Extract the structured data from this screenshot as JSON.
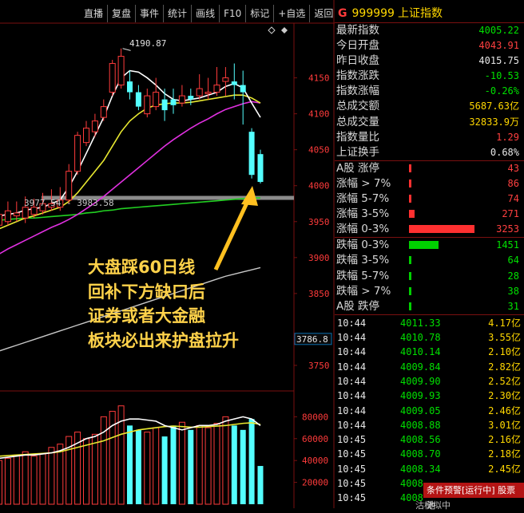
{
  "toolbar": [
    "直播",
    "复盘",
    "事件",
    "统计",
    "画线",
    "F10",
    "标记",
    "+自选",
    "返回"
  ],
  "header": {
    "letter": "G",
    "code": "999999",
    "name": "上证指数"
  },
  "quote": [
    {
      "label": "最新指数",
      "value": "4005.22",
      "color": "#00e000"
    },
    {
      "label": "今日开盘",
      "value": "4043.91",
      "color": "#ff4040"
    },
    {
      "label": "昨日收盘",
      "value": "4015.75",
      "color": "#e8e8e8"
    },
    {
      "label": "指数涨跌",
      "value": "-10.53",
      "color": "#00e000"
    },
    {
      "label": "指数涨幅",
      "value": "-0.26%",
      "color": "#00e000"
    },
    {
      "label": "总成交额",
      "value": "5687.63亿",
      "color": "#ffd700"
    },
    {
      "label": "总成交量",
      "value": "32833.9万",
      "color": "#ffd700"
    },
    {
      "label": "指数量比",
      "value": "1.29",
      "color": "#ff4040"
    },
    {
      "label": "上证换手",
      "value": "0.68%",
      "color": "#e8e8e8"
    }
  ],
  "breadth_up": [
    {
      "label": "A股 涨停",
      "count": "43",
      "ratio": 0.01
    },
    {
      "label": "涨幅 > 7%",
      "count": "86",
      "ratio": 0.03
    },
    {
      "label": "涨幅 5-7%",
      "count": "74",
      "ratio": 0.02
    },
    {
      "label": "涨幅 3-5%",
      "count": "271",
      "ratio": 0.08
    },
    {
      "label": "涨幅 0-3%",
      "count": "3253",
      "ratio": 1.0
    }
  ],
  "breadth_down": [
    {
      "label": "跌幅 0-3%",
      "count": "1451",
      "ratio": 0.45
    },
    {
      "label": "跌幅 3-5%",
      "count": "64",
      "ratio": 0.02
    },
    {
      "label": "跌幅 5-7%",
      "count": "28",
      "ratio": 0.01
    },
    {
      "label": "跌幅 > 7%",
      "count": "38",
      "ratio": 0.01
    },
    {
      "label": "A股 跌停",
      "count": "31",
      "ratio": 0.01
    }
  ],
  "ticks": [
    {
      "time": "10:44",
      "price": "4011.33",
      "vol": "4.17亿"
    },
    {
      "time": "10:44",
      "price": "4010.78",
      "vol": "3.55亿"
    },
    {
      "time": "10:44",
      "price": "4010.14",
      "vol": "2.10亿"
    },
    {
      "time": "10:44",
      "price": "4009.84",
      "vol": "2.82亿"
    },
    {
      "time": "10:44",
      "price": "4009.90",
      "vol": "2.52亿"
    },
    {
      "time": "10:44",
      "price": "4009.93",
      "vol": "2.30亿"
    },
    {
      "time": "10:44",
      "price": "4009.05",
      "vol": "2.46亿"
    },
    {
      "time": "10:44",
      "price": "4008.88",
      "vol": "3.01亿"
    },
    {
      "time": "10:45",
      "price": "4008.56",
      "vol": "2.16亿"
    },
    {
      "time": "10:45",
      "price": "4008.70",
      "vol": "2.18亿"
    },
    {
      "time": "10:45",
      "price": "4008.34",
      "vol": "2.45亿"
    },
    {
      "time": "10:45",
      "price": "4008.",
      "vol": ""
    },
    {
      "time": "10:45",
      "price": "4008",
      "vol": ""
    }
  ],
  "alert": {
    "text": "条件预警[运行中] 股票池",
    "sub": "沽模拟中"
  },
  "price_axis": [
    "4150",
    "4100",
    "4050",
    "4000",
    "3950",
    "3900",
    "3850",
    "3750"
  ],
  "volume_axis": [
    "80000",
    "60000",
    "40000",
    "20000"
  ],
  "current_price_tag": "3786.8",
  "annotations": {
    "high": "4190.87",
    "gap": "3977.54 - 3983.58",
    "note": [
      "大盘踩60日线",
      "回补下方缺口后",
      "证券或者大金融",
      "板块必出来护盘拉升"
    ]
  },
  "chart_data": {
    "type": "candlestick",
    "ylim": [
      3720,
      4225
    ],
    "candles": [
      {
        "o": 3945,
        "c": 3960,
        "h": 3975,
        "l": 3935
      },
      {
        "o": 3950,
        "c": 3965,
        "h": 3978,
        "l": 3945
      },
      {
        "o": 3958,
        "c": 3962,
        "h": 3978,
        "l": 3950
      },
      {
        "o": 3955,
        "c": 3970,
        "h": 3985,
        "l": 3948
      },
      {
        "o": 3960,
        "c": 3970,
        "h": 3982,
        "l": 3955
      },
      {
        "o": 3965,
        "c": 3975,
        "h": 3990,
        "l": 3960
      },
      {
        "o": 3970,
        "c": 3975,
        "h": 3995,
        "l": 3965
      },
      {
        "o": 3970,
        "c": 3980,
        "h": 3998,
        "l": 3965
      },
      {
        "o": 3980,
        "c": 4020,
        "h": 4030,
        "l": 3975
      },
      {
        "o": 4020,
        "c": 4070,
        "h": 4075,
        "l": 4015
      },
      {
        "o": 4060,
        "c": 4080,
        "h": 4090,
        "l": 4055
      },
      {
        "o": 4075,
        "c": 4090,
        "h": 4100,
        "l": 4068
      },
      {
        "o": 4095,
        "c": 4110,
        "h": 4120,
        "l": 4090
      },
      {
        "o": 4130,
        "c": 4170,
        "h": 4175,
        "l": 4125
      },
      {
        "o": 4140,
        "c": 4180,
        "h": 4190.87,
        "l": 4135
      },
      {
        "o": 4145,
        "c": 4130,
        "h": 4160,
        "l": 4120
      },
      {
        "o": 4130,
        "c": 4110,
        "h": 4140,
        "l": 4105
      },
      {
        "o": 4100,
        "c": 4125,
        "h": 4135,
        "l": 4095
      },
      {
        "o": 4110,
        "c": 4130,
        "h": 4150,
        "l": 4105
      },
      {
        "o": 4120,
        "c": 4105,
        "h": 4135,
        "l": 4090
      },
      {
        "o": 4120,
        "c": 4112,
        "h": 4135,
        "l": 4100
      },
      {
        "o": 4115,
        "c": 4125,
        "h": 4140,
        "l": 4110
      },
      {
        "o": 4125,
        "c": 4120,
        "h": 4135,
        "l": 4112
      },
      {
        "o": 4125,
        "c": 4135,
        "h": 4155,
        "l": 4120
      },
      {
        "o": 4128,
        "c": 4130,
        "h": 4150,
        "l": 4120
      },
      {
        "o": 4130,
        "c": 4140,
        "h": 4165,
        "l": 4125
      },
      {
        "o": 4145,
        "c": 4150,
        "h": 4165,
        "l": 4125
      },
      {
        "o": 4145,
        "c": 4140,
        "h": 4170,
        "l": 4120
      },
      {
        "o": 4140,
        "c": 4130,
        "h": 4160,
        "l": 4085
      },
      {
        "o": 4075,
        "c": 4015,
        "h": 4080,
        "l": 4010
      },
      {
        "o": 4043.91,
        "c": 4005.22,
        "h": 4050,
        "l": 4003
      }
    ],
    "ma5": [
      3958,
      3960,
      3962,
      3966,
      3968,
      3970,
      3975,
      3980,
      3998,
      4020,
      4045,
      4070,
      4095,
      4125,
      4150,
      4160,
      4158,
      4150,
      4140,
      4128,
      4120,
      4118,
      4120,
      4122,
      4126,
      4130,
      4138,
      4142,
      4136,
      4115,
      4095
    ],
    "ma10": [
      3940,
      3945,
      3950,
      3955,
      3958,
      3962,
      3966,
      3970,
      3978,
      3990,
      4005,
      4020,
      4035,
      4055,
      4075,
      4090,
      4100,
      4108,
      4112,
      4114,
      4115,
      4115,
      4116,
      4118,
      4120,
      4122,
      4124,
      4126,
      4126,
      4122,
      4115
    ],
    "ma20": [
      3905,
      3912,
      3918,
      3924,
      3930,
      3936,
      3942,
      3947,
      3953,
      3960,
      3968,
      3976,
      3985,
      3995,
      4005,
      4015,
      4025,
      4035,
      4045,
      4055,
      4064,
      4072,
      4080,
      4087,
      4093,
      4100,
      4106,
      4110,
      4114,
      4117,
      4115
    ],
    "ma60": [
      3952,
      3953,
      3954,
      3955,
      3955,
      3956,
      3957,
      3958,
      3959,
      3960,
      3962,
      3963,
      3965,
      3966,
      3968,
      3969,
      3970,
      3971,
      3972,
      3973,
      3974,
      3975,
      3976,
      3977,
      3978,
      3979,
      3980,
      3981,
      3982,
      3983,
      3983
    ],
    "ma120": [
      3770,
      3774,
      3778,
      3782,
      3786,
      3790,
      3794,
      3798,
      3802,
      3806,
      3810,
      3814,
      3818,
      3822,
      3826,
      3830,
      3834,
      3838,
      3842,
      3846,
      3850,
      3854,
      3858,
      3862,
      3866,
      3870,
      3874,
      3877,
      3880,
      3883,
      3886
    ],
    "volume_ylim": [
      0,
      100000
    ],
    "volume": [
      40000,
      42000,
      45000,
      48000,
      44000,
      46000,
      52000,
      55000,
      62000,
      66000,
      60000,
      64000,
      80000,
      85000,
      90000,
      72000,
      68000,
      66000,
      70000,
      62000,
      72000,
      75000,
      68000,
      72000,
      70000,
      74000,
      80000,
      72000,
      68000,
      78000,
      35000
    ],
    "vol_ma5": [
      42000,
      43000,
      44000,
      45000,
      45000,
      46000,
      47000,
      49000,
      52000,
      56000,
      60000,
      62000,
      66000,
      72000,
      76000,
      78000,
      78000,
      77000,
      76000,
      72000,
      70000,
      68000,
      70000,
      72000,
      72000,
      73000,
      76000,
      78000,
      80000,
      78000,
      72000
    ],
    "vol_ma10": [
      44000,
      44500,
      45000,
      45500,
      46000,
      46500,
      47000,
      48000,
      50000,
      52000,
      54000,
      56000,
      58000,
      61000,
      64000,
      66000,
      68000,
      69000,
      70000,
      71000,
      71500,
      71000,
      70500,
      70500,
      71000,
      71500,
      72000,
      73000,
      74000,
      74500,
      73000
    ]
  }
}
